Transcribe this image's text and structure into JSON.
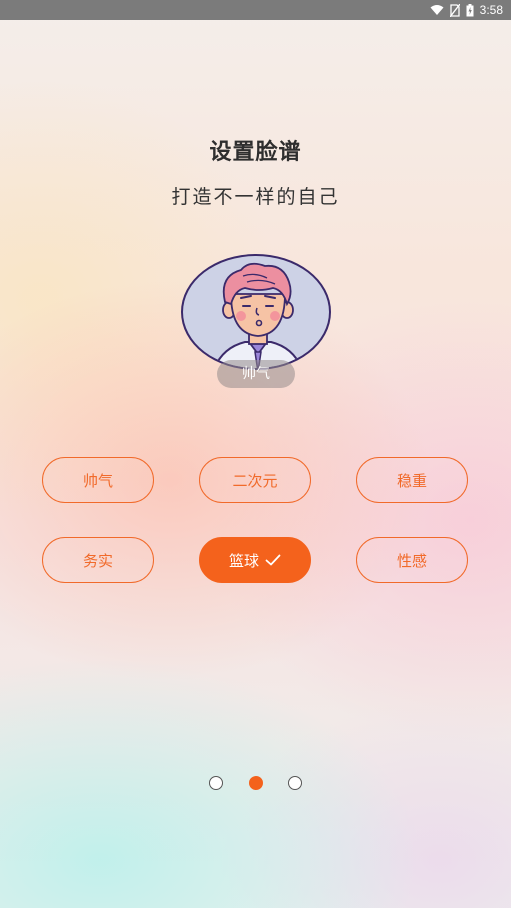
{
  "status_bar": {
    "time": "3:58",
    "icons": [
      "wifi-icon",
      "no-sim-icon",
      "battery-charging-icon"
    ]
  },
  "header": {
    "title": "设置脸谱",
    "subtitle": "打造不一样的自己"
  },
  "avatar": {
    "label": "帅气"
  },
  "tags": [
    {
      "label": "帅气",
      "selected": false
    },
    {
      "label": "二次元",
      "selected": false
    },
    {
      "label": "稳重",
      "selected": false
    },
    {
      "label": "务实",
      "selected": false
    },
    {
      "label": "篮球",
      "selected": true
    },
    {
      "label": "性感",
      "selected": false
    }
  ],
  "pager": {
    "count": 3,
    "active_index": 1
  },
  "colors": {
    "accent": "#f4621c",
    "status_bar": "#7b7b7b",
    "title": "#2e2e2e"
  }
}
